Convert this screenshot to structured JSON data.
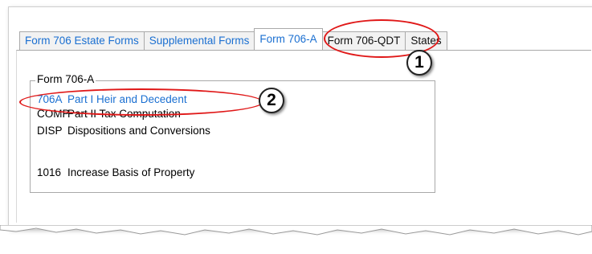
{
  "tabs": [
    {
      "label": "Form 706 Estate Forms",
      "active": false
    },
    {
      "label": "Supplemental Forms",
      "active": false
    },
    {
      "label": "Form 706-A",
      "active": true
    },
    {
      "label": "Form 706-QDT",
      "active": false
    },
    {
      "label": "States",
      "active": false
    }
  ],
  "group": {
    "title": "Form 706-A",
    "items": [
      {
        "code": "706A",
        "label": "Part I Heir and Decedent"
      },
      {
        "code": "COMP",
        "label": "Part II Tax Computation"
      },
      {
        "code": "DISP",
        "label": "Dispositions and Conversions"
      },
      {
        "code": "1016",
        "label": "Increase Basis of Property"
      }
    ]
  },
  "callouts": [
    "1",
    "2"
  ],
  "colors": {
    "link": "#1a6fd1",
    "callout": "#e01818"
  }
}
